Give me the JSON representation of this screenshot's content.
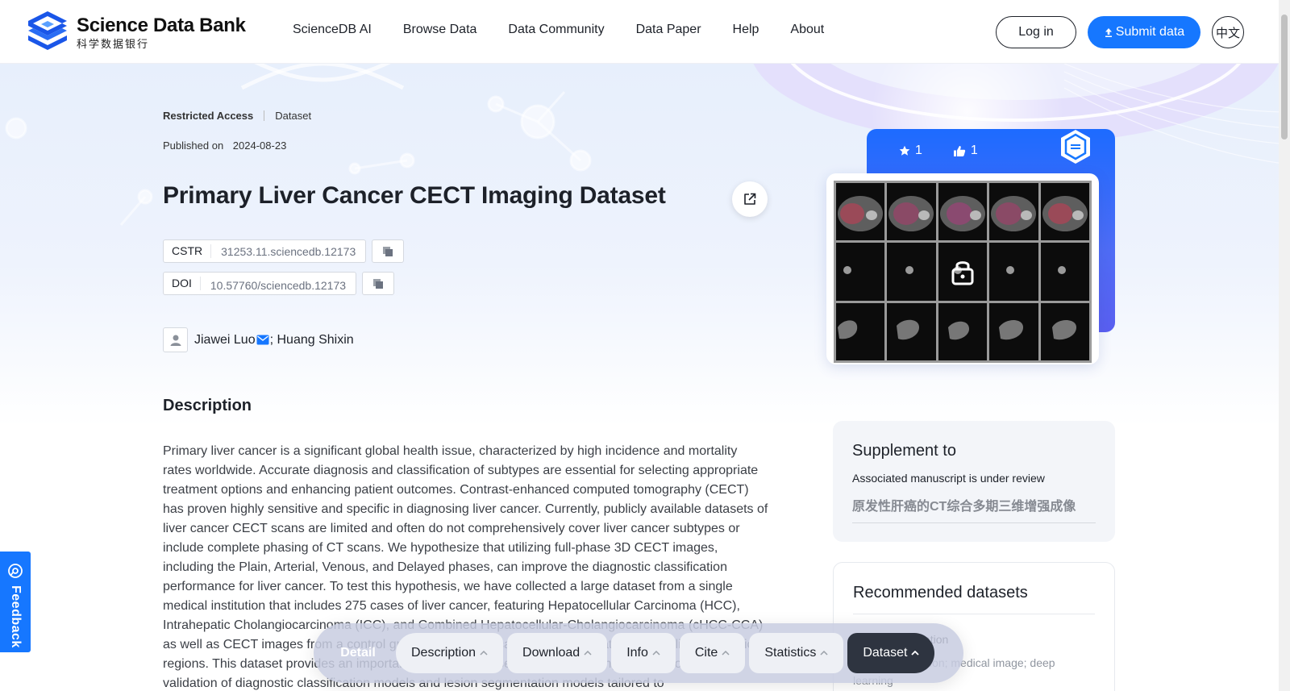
{
  "header": {
    "logo_en": "Science Data Bank",
    "logo_zh": "科学数据银行",
    "nav": [
      "ScienceDB AI",
      "Browse Data",
      "Data Community",
      "Data Paper",
      "Help",
      "About"
    ],
    "login": "Log in",
    "submit": "Submit data",
    "lang": "中文"
  },
  "dataset": {
    "access": "Restricted Access",
    "type": "Dataset",
    "published_label": "Published on",
    "published_date": "2024-08-23",
    "title": "Primary Liver Cancer CECT Imaging Dataset",
    "cstr_label": "CSTR",
    "cstr_value": "31253.11.sciencedb.12173",
    "doi_label": "DOI",
    "doi_value": "10.57760/sciencedb.12173",
    "author1": "Jiawei Luo",
    "author_sep": "; ",
    "author2": "Huang Shixin"
  },
  "description": {
    "heading": "Description",
    "text": "Primary liver cancer is a significant global health issue, characterized by high incidence and mortality rates worldwide. Accurate diagnosis and classification of subtypes are essential for selecting appropriate treatment options and enhancing patient outcomes. Contrast-enhanced computed tomography (CECT) has proven highly sensitive and specific in diagnosing liver cancer. Currently, publicly available datasets of liver cancer CECT scans are limited and often do not comprehensively cover liver cancer subtypes or include complete phasing of CT scans. We hypothesize that utilizing full-phase 3D CECT images, including the Plain, Arterial, Venous, and Delayed phases, can improve the diagnostic classification performance for liver cancer. To test this hypothesis, we have collected a large dataset from a single medical institution that includes 275 cases of liver cancer, featuring Hepatocellular Carcinoma (HCC), Intrahepatic Cholangiocarcinoma (ICC), and Combined Hepatocellular-Cholangiocarcinoma (cHCC-CCA) as well as CECT images from a control group without liver cancer, with annotations of the liver and lesion regions. This dataset provides an important resource for researchers, facilitating the development and validation of diagnostic classification models and lesion segmentation models tailored to"
  },
  "card": {
    "stars": "1",
    "likes": "1"
  },
  "supplement": {
    "heading": "Supplement to",
    "note": "Associated manuscript is under review",
    "zh_title": "原发性肝癌的CT综合多期三维增强成像"
  },
  "recommended": {
    "heading": "Recommended datasets",
    "item": "Liver segmentation",
    "keywords": "liver segmentation; medical image; deep learning"
  },
  "feedback": "Feedback",
  "tabbar": {
    "detail": "Detail",
    "tabs": [
      "Description",
      "Download",
      "Info",
      "Cite",
      "Statistics",
      "Dataset"
    ]
  },
  "colors": {
    "primary": "#1677ff",
    "dark_tab": "#2e3440"
  }
}
